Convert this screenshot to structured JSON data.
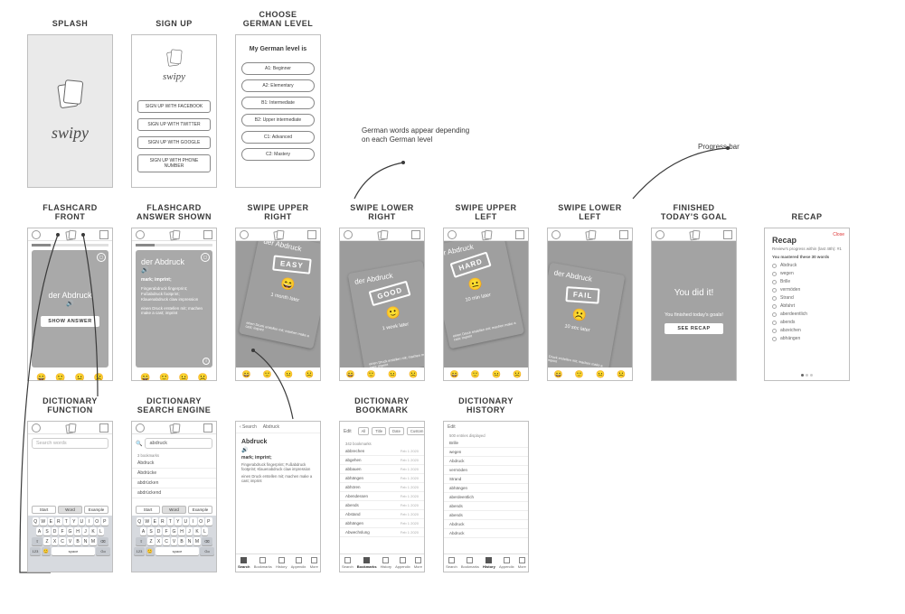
{
  "row1": {
    "splash_title": "SPLASH",
    "splash_brand": "swipy",
    "signup_title": "SIGN UP",
    "signup_brand": "swipy",
    "signup_buttons": [
      "SIGN UP WITH FACEBOOK",
      "SIGN UP WITH TWITTER",
      "SIGN UP WITH GOOGLE",
      "SIGN UP WITH PHONE NUMBER"
    ],
    "level_title": "CHOOSE\nGERMAN LEVEL",
    "level_heading": "My German level is",
    "level_options": [
      "A1: Beginner",
      "A2: Elementary",
      "B1: Intermediate",
      "B2: Upper intermediate",
      "C1: Advanced",
      "C2: Mastery"
    ]
  },
  "annotations": {
    "german_words": "German words appear depending on each German level",
    "progress_bar": "Progress bar"
  },
  "row2": {
    "fc_front_title": "FLASHCARD\nFRONT",
    "fc_word": "der Abdruck",
    "fc_speaker": "🔊",
    "show_answer": "SHOW ANSWER",
    "emojis": [
      "😄",
      "🙂",
      "😐",
      "☹️"
    ],
    "fc_answer_title": "FLASHCARD\nANSWER SHOWN",
    "fc_answer_sub": "mark; imprint;",
    "fc_answer_text1": "Fingerabdruck fingerprint; Fußabdruck footprint; Klauenabdruck claw impression",
    "fc_answer_text2": "einen Druck erstellen mit; machen make a cast; imprint",
    "swipe_ur_title": "SWIPE UPPER\nRIGHT",
    "swipe_lr_title": "SWIPE LOWER\nRIGHT",
    "swipe_ul_title": "SWIPE UPPER\nLEFT",
    "swipe_ll_title": "SWIPE LOWER\nLEFT",
    "stamp_easy": "EASY",
    "later_easy": "1 month later",
    "face_easy": "😄",
    "stamp_good": "GOOD",
    "later_good": "1 week later",
    "face_good": "🙂",
    "stamp_hard": "HARD",
    "later_hard": "10 min later",
    "face_hard": "😐",
    "stamp_fail": "FAIL",
    "later_fail": "10 sec later",
    "face_fail": "☹️",
    "tilt_word": "der Abdruck",
    "tilt_sub": "mark; imprint;",
    "tilt_txt": "einen Druck erstellen mit; machen make a cast; imprint",
    "finish_title": "FINISHED\nTODAY'S GOAL",
    "finish_big": "You did it!",
    "finish_sub": "You finished today's goals!",
    "finish_btn": "SEE RECAP",
    "recap_title": "RECAP",
    "recap_h": "Recap",
    "recap_close": "Close",
    "recap_sub1": "Review's progress within (last 48h): #1",
    "recap_sub2": "You mastered these 30 words",
    "recap_items": [
      "Abdruck",
      "wegen",
      "Brille",
      "vermöden",
      "Strand",
      "Abfahrt",
      "aberdeentlich",
      "abends",
      "abzeichen",
      "abhängen"
    ]
  },
  "row3": {
    "dfunc_title": "DICTIONARY\nFUNCTION",
    "search_ph": "Search words",
    "filters": [
      "Start",
      "Word",
      "Example"
    ],
    "keys_r1": [
      "Q",
      "W",
      "E",
      "R",
      "T",
      "Y",
      "U",
      "I",
      "O",
      "P"
    ],
    "keys_r2": [
      "A",
      "S",
      "D",
      "F",
      "G",
      "H",
      "J",
      "K",
      "L"
    ],
    "keys_r3": [
      "Z",
      "X",
      "C",
      "V",
      "B",
      "N",
      "M"
    ],
    "key_shift": "⇧",
    "key_back": "⌫",
    "key_123": "123",
    "key_emoji": "😊",
    "key_space": "space",
    "key_go": "Go",
    "dse_title": "DICTIONARY\nSEARCH ENGINE",
    "dse_input": "abdruck",
    "dse_count": "3 bookmarks",
    "dse_suggest": [
      "Abdruck",
      "Abdrücke",
      "abdrücken",
      "abdrückend"
    ],
    "detail_back": "‹ Search",
    "detail_crumb": "Abdruck",
    "detail_word": "Abdruck",
    "detail_sp": "🔊",
    "detail_def": "mark; imprint;",
    "detail_p1": "Fingerabdruck fingerprint; Fußabdruck footprint; Klauenabdruck claw impression",
    "detail_p2": "einen Druck erstellen mit; machen make a cast; imprint",
    "tabs": [
      "Search",
      "Bookmarks",
      "History",
      "Appendix",
      "More"
    ],
    "dbm_title": "DICTIONARY\nBOOKMARK",
    "dbm_edit": "Edit",
    "dbm_filters": [
      "All",
      "Title",
      "Date",
      "Custom"
    ],
    "dbm_count": "342 bookmarks",
    "dbm_items": [
      {
        "w": "abbrechen",
        "d": "Feb 1 2020"
      },
      {
        "w": "abgehen",
        "d": "Feb 1 2020"
      },
      {
        "w": "abbauen",
        "d": "Feb 1 2020"
      },
      {
        "w": "abhängen",
        "d": "Feb 1 2020"
      },
      {
        "w": "abhören",
        "d": "Feb 1 2020"
      },
      {
        "w": "Abendessen",
        "d": "Feb 1 2020"
      },
      {
        "w": "abends",
        "d": "Feb 1 2020"
      },
      {
        "w": "Abstand",
        "d": "Feb 1 2020"
      },
      {
        "w": "abhängen",
        "d": "Feb 1 2020"
      },
      {
        "w": "Abwechslung",
        "d": "Feb 1 2020"
      }
    ],
    "dh_title": "DICTIONARY\nHISTORY",
    "dh_count": "500 entries displayed",
    "dh_items": [
      "Brille",
      "wegen",
      "Abdruck",
      "vermöden",
      "Strand",
      "abhängen",
      "aberdeentlich",
      "abends",
      "abends",
      "Abdruck",
      "Abdruck"
    ]
  }
}
